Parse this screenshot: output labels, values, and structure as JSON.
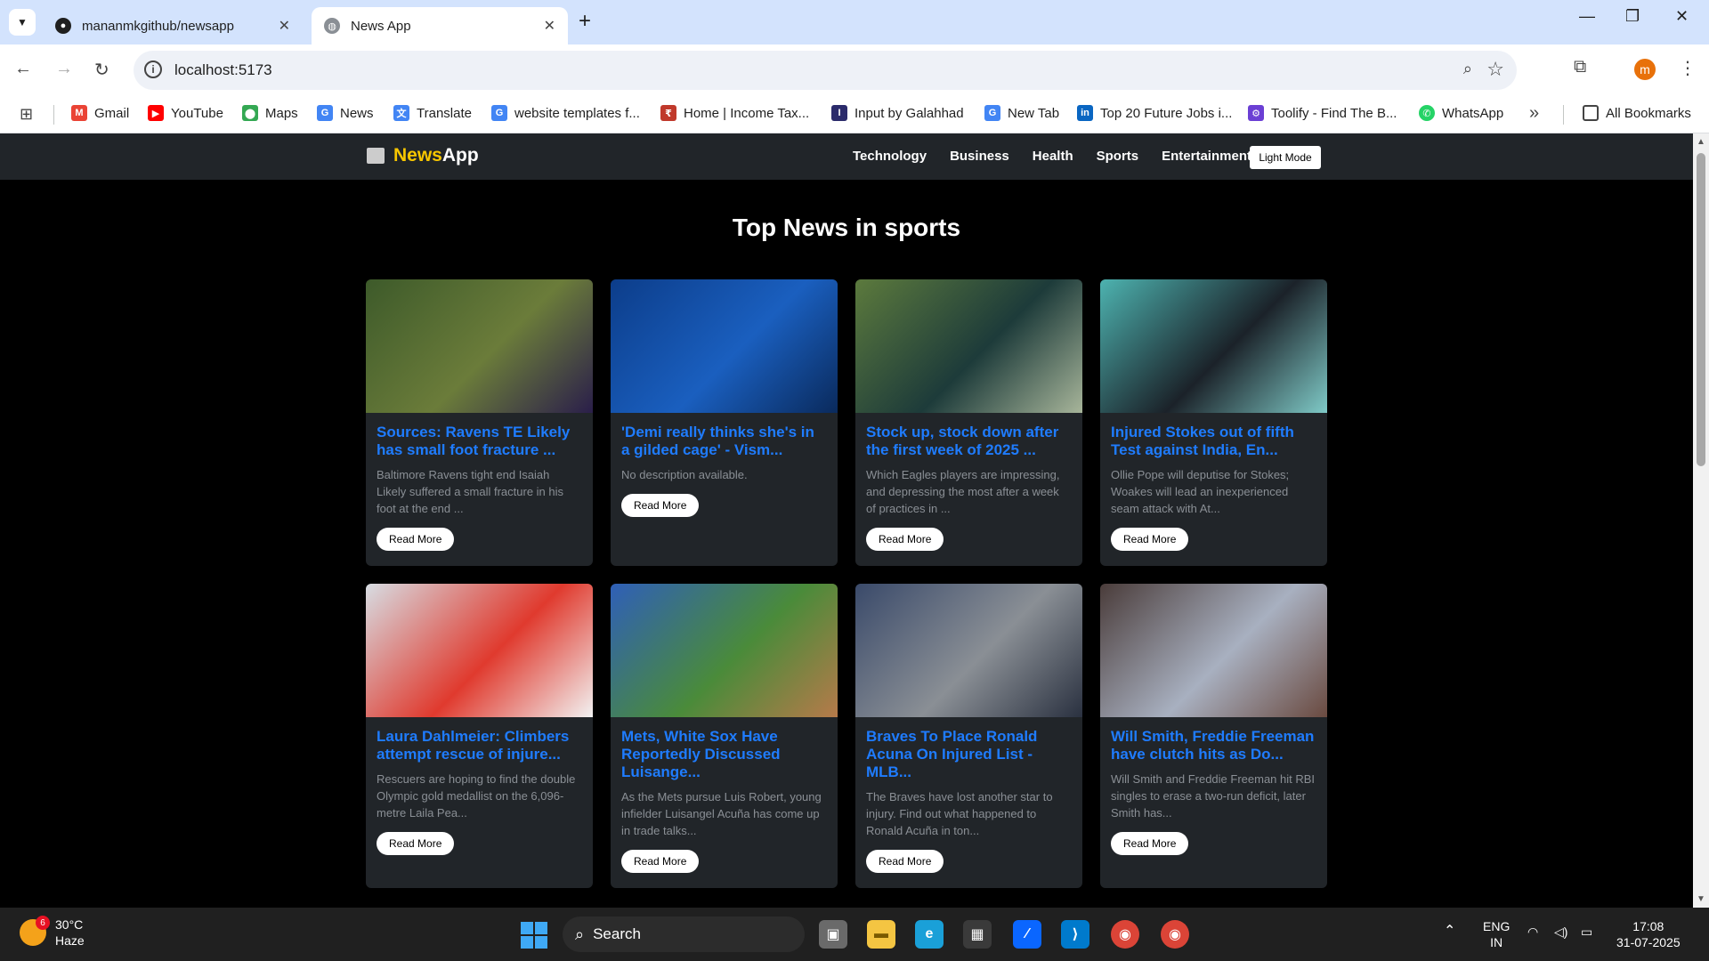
{
  "browser": {
    "tabs": [
      {
        "title": "mananmkgithub/newsapp",
        "active": false
      },
      {
        "title": "News App",
        "active": true
      }
    ],
    "url": "localhost:5173",
    "profile_initial": "m",
    "bookmarks": [
      {
        "label": "Gmail",
        "icon": "gmail-icon",
        "color": "#ea4335"
      },
      {
        "label": "YouTube",
        "icon": "youtube-icon",
        "color": "#ff0000"
      },
      {
        "label": "Maps",
        "icon": "maps-icon",
        "color": "#34a853"
      },
      {
        "label": "News",
        "icon": "google-news-icon",
        "color": "#4285f4"
      },
      {
        "label": "Translate",
        "icon": "translate-icon",
        "color": "#4285f4"
      },
      {
        "label": "website templates f...",
        "icon": "google-icon",
        "color": "#4285f4"
      },
      {
        "label": "Home | Income Tax...",
        "icon": "income-tax-icon",
        "color": "#c0392b"
      },
      {
        "label": "Input by Galahhad",
        "icon": "input-icon",
        "color": "#2b2b6b"
      },
      {
        "label": "New Tab",
        "icon": "google-icon",
        "color": "#4285f4"
      },
      {
        "label": "Top 20 Future Jobs i...",
        "icon": "linkedin-icon",
        "color": "#0a66c2"
      },
      {
        "label": "Toolify - Find The B...",
        "icon": "toolify-icon",
        "color": "#6b3fd4"
      },
      {
        "label": "WhatsApp",
        "icon": "whatsapp-icon",
        "color": "#25d366"
      }
    ],
    "all_bookmarks": "All Bookmarks"
  },
  "app": {
    "brand_prefix": "News",
    "brand_suffix": "App",
    "nav": [
      "Technology",
      "Business",
      "Health",
      "Sports",
      "Entertainment"
    ],
    "mode_button": "Light Mode",
    "heading": "Top News in sports",
    "read_more": "Read More",
    "articles": [
      {
        "title": "Sources: Ravens TE Likely has small foot fracture ...",
        "desc": "Baltimore Ravens tight end Isaiah Likely suffered a small fracture in his foot at the end ...",
        "img": [
          "#3d5a2a",
          "#6b7c3a",
          "#2a1e4a"
        ]
      },
      {
        "title": "'Demi really thinks she's in a gilded cage' - Vism...",
        "desc": "No description available.",
        "img": [
          "#0c3d8a",
          "#1a5fbf",
          "#0a2a5c"
        ]
      },
      {
        "title": "Stock up, stock down after the first week of 2025 ...",
        "desc": "Which Eagles players are impressing, and depressing the most after a week of practices in ...",
        "img": [
          "#5c7a3d",
          "#1d3b3a",
          "#a7b59a"
        ]
      },
      {
        "title": "Injured Stokes out of fifth Test against India, En...",
        "desc": "Ollie Pope will deputise for Stokes; Woakes will lead an inexperienced seam attack with At...",
        "img": [
          "#4db3b0",
          "#1b2229",
          "#7fcac7"
        ]
      },
      {
        "title": "Laura Dahlmeier: Climbers attempt rescue of injure...",
        "desc": "Rescuers are hoping to find the double Olympic gold medallist on the 6,096-metre Laila Pea...",
        "img": [
          "#d7dde3",
          "#e03a2e",
          "#f2f2f2"
        ]
      },
      {
        "title": "Mets, White Sox Have Reportedly Discussed Luisange...",
        "desc": "As the Mets pursue Luis Robert, young infielder Luisangel Acuña has come up in trade talks...",
        "img": [
          "#2f5fb8",
          "#4a8b3a",
          "#b67a4a"
        ]
      },
      {
        "title": "Braves To Place Ronald Acuna On Injured List - MLB...",
        "desc": "The Braves have lost another star to injury. Find out what happened to Ronald Acuña in ton...",
        "img": [
          "#3a4a6a",
          "#8a8f95",
          "#2a3140"
        ]
      },
      {
        "title": "Will Smith, Freddie Freeman have clutch hits as Do...",
        "desc": "Will Smith and Freddie Freeman hit RBI singles to erase a two-run deficit, later Smith has...",
        "img": [
          "#4a3c3a",
          "#a8b0c0",
          "#6a4a40"
        ]
      }
    ]
  },
  "taskbar": {
    "temperature": "30°C",
    "condition": "Haze",
    "weather_badge": "6",
    "search": "Search",
    "lang1": "ENG",
    "lang2": "IN",
    "time": "17:08",
    "date": "31-07-2025",
    "chrome_badge": "m"
  }
}
